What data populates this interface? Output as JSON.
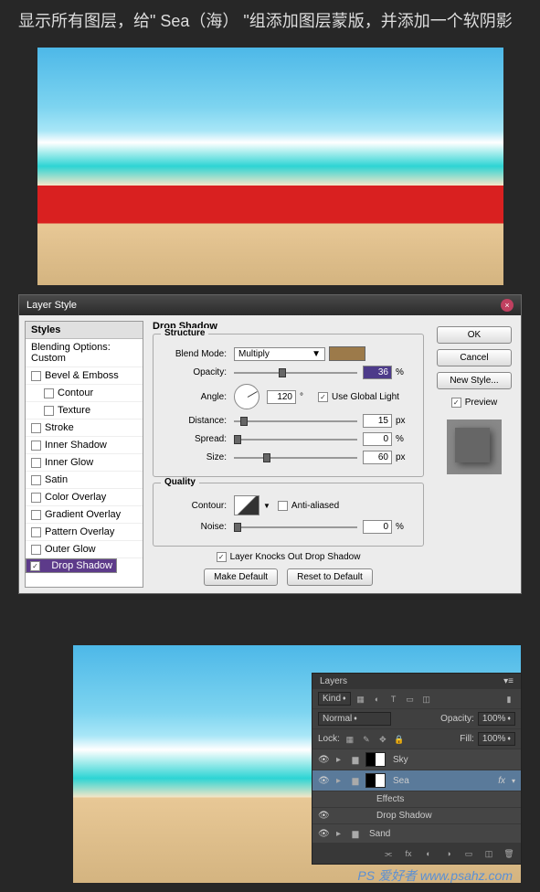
{
  "header": "显示所有图层，给\" Sea（海） \"组添加图层蒙版，并添加一个软阴影",
  "dialog": {
    "title": "Layer Style",
    "styles_header": "Styles",
    "blending": "Blending Options: Custom",
    "items": [
      {
        "label": "Bevel & Emboss",
        "checked": false,
        "indent": false
      },
      {
        "label": "Contour",
        "checked": false,
        "indent": true
      },
      {
        "label": "Texture",
        "checked": false,
        "indent": true
      },
      {
        "label": "Stroke",
        "checked": false,
        "indent": false
      },
      {
        "label": "Inner Shadow",
        "checked": false,
        "indent": false
      },
      {
        "label": "Inner Glow",
        "checked": false,
        "indent": false
      },
      {
        "label": "Satin",
        "checked": false,
        "indent": false
      },
      {
        "label": "Color Overlay",
        "checked": false,
        "indent": false
      },
      {
        "label": "Gradient Overlay",
        "checked": false,
        "indent": false
      },
      {
        "label": "Pattern Overlay",
        "checked": false,
        "indent": false
      },
      {
        "label": "Outer Glow",
        "checked": false,
        "indent": false
      },
      {
        "label": "Drop Shadow",
        "checked": true,
        "indent": false,
        "selected": true
      }
    ],
    "section_title": "Drop Shadow",
    "structure": "Structure",
    "blend_mode_lbl": "Blend Mode:",
    "blend_mode_val": "Multiply",
    "opacity_lbl": "Opacity:",
    "opacity_val": "36",
    "opacity_unit": "%",
    "angle_lbl": "Angle:",
    "angle_val": "120",
    "angle_unit": "°",
    "global_light": "Use Global Light",
    "distance_lbl": "Distance:",
    "distance_val": "15",
    "distance_unit": "px",
    "spread_lbl": "Spread:",
    "spread_val": "0",
    "spread_unit": "%",
    "size_lbl": "Size:",
    "size_val": "60",
    "size_unit": "px",
    "quality": "Quality",
    "contour_lbl": "Contour:",
    "anti_aliased": "Anti-aliased",
    "noise_lbl": "Noise:",
    "noise_val": "0",
    "noise_unit": "%",
    "knockout": "Layer Knocks Out Drop Shadow",
    "make_default": "Make Default",
    "reset_default": "Reset to Default",
    "ok": "OK",
    "cancel": "Cancel",
    "new_style": "New Style...",
    "preview": "Preview"
  },
  "layers": {
    "title": "Layers",
    "kind": "Kind",
    "mode": "Normal",
    "opacity_lbl": "Opacity:",
    "opacity_val": "100%",
    "lock_lbl": "Lock:",
    "fill_lbl": "Fill:",
    "fill_val": "100%",
    "items": [
      {
        "name": "Sky",
        "mask": true
      },
      {
        "name": "Sea",
        "mask": true,
        "fx": true,
        "selected": true
      },
      {
        "name": "Effects",
        "sub": true
      },
      {
        "name": "Drop Shadow",
        "sub": true,
        "eye": true
      },
      {
        "name": "Sand"
      }
    ]
  },
  "watermark": "PS 爱好者 www.psahz.com"
}
